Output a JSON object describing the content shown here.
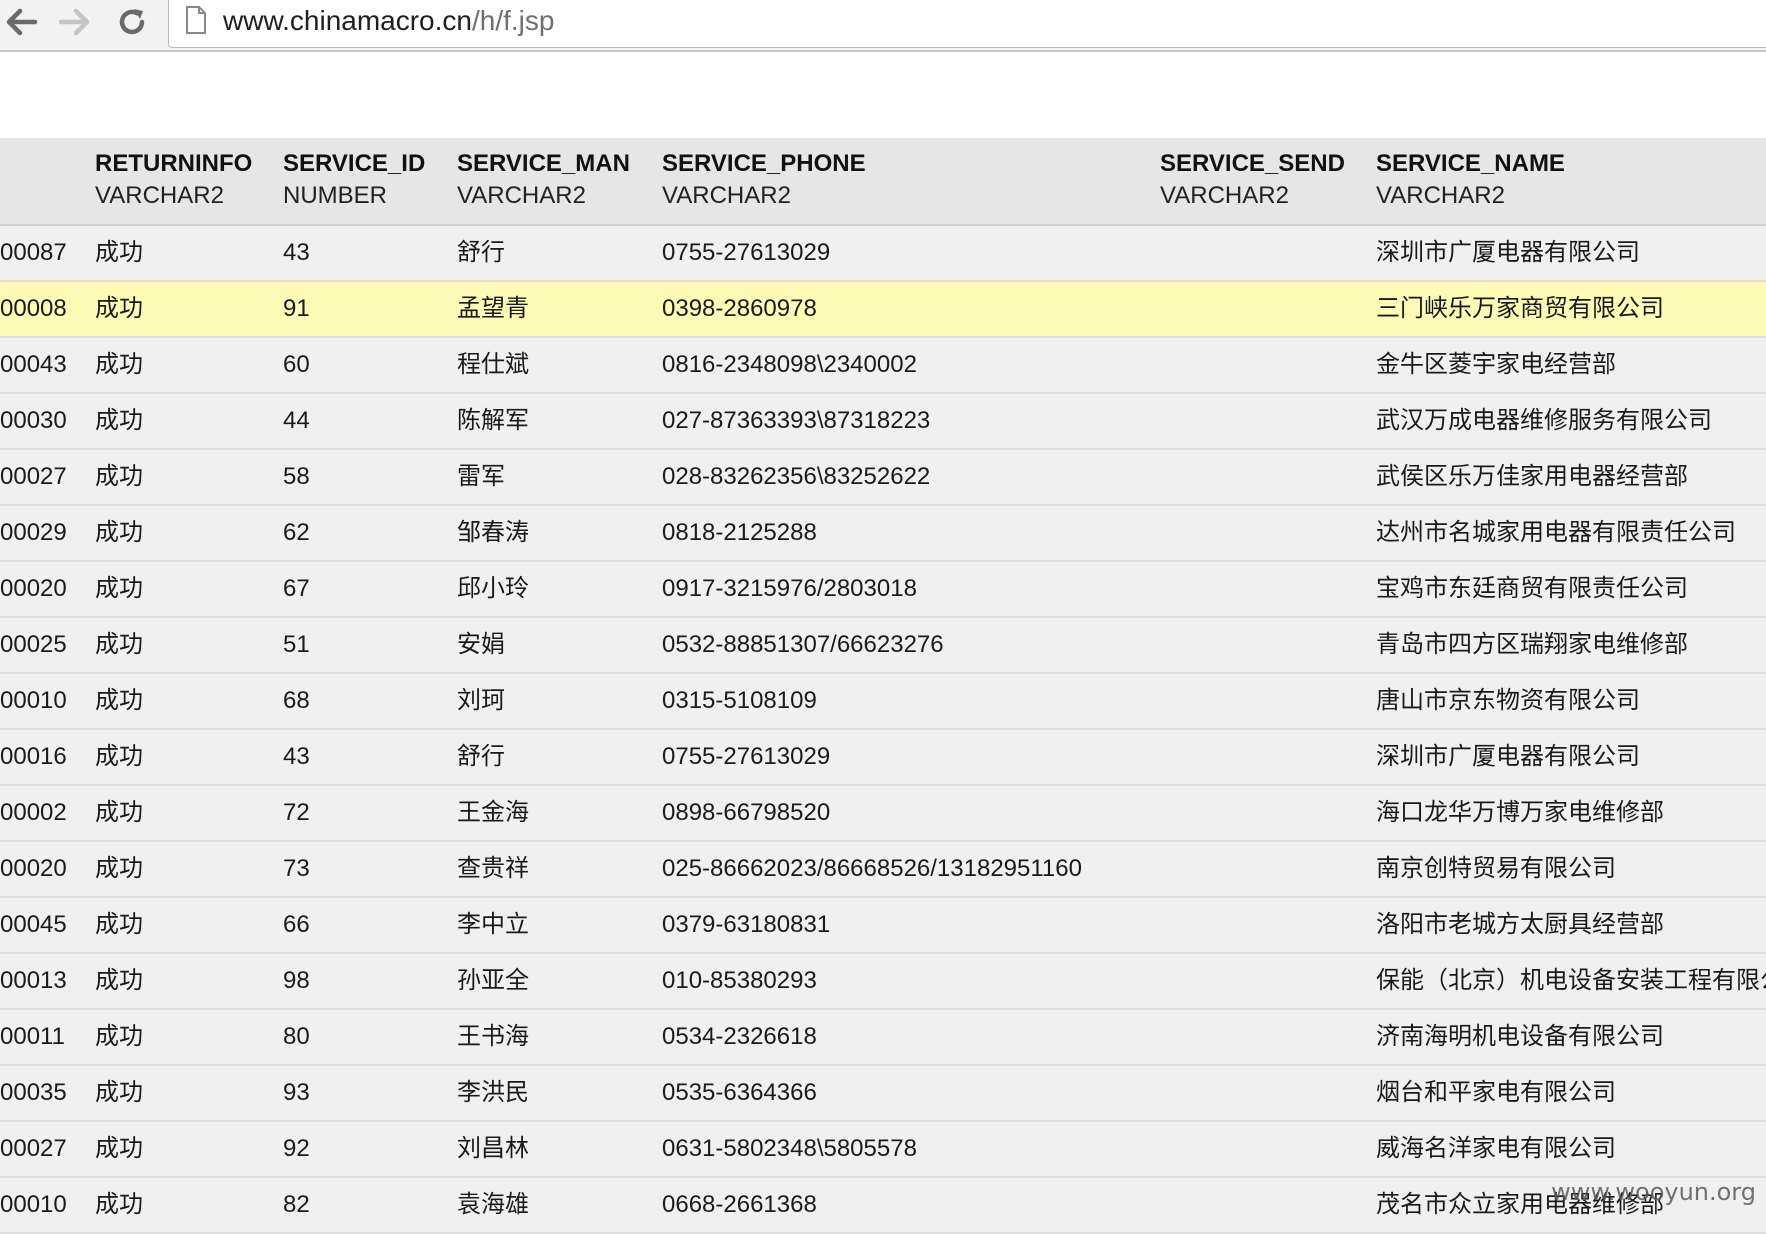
{
  "browser": {
    "url_host": "www.chinamacro.cn",
    "url_path": "/h/f.jsp"
  },
  "table": {
    "columns": [
      {
        "name": "",
        "type": ""
      },
      {
        "name": "RETURNINFO",
        "type": "VARCHAR2"
      },
      {
        "name": "SERVICE_ID",
        "type": "NUMBER"
      },
      {
        "name": "SERVICE_MAN",
        "type": "VARCHAR2"
      },
      {
        "name": "SERVICE_PHONE",
        "type": "VARCHAR2"
      },
      {
        "name": "SERVICE_SEND",
        "type": "VARCHAR2"
      },
      {
        "name": "SERVICE_NAME",
        "type": "VARCHAR2"
      }
    ],
    "rows": [
      [
        "00087",
        "成功",
        "43",
        "舒行",
        "0755-27613029",
        "",
        "深圳市广厦电器有限公司"
      ],
      [
        "00008",
        "成功",
        "91",
        "孟望青",
        "0398-2860978",
        "",
        "三门峡乐万家商贸有限公司"
      ],
      [
        "00043",
        "成功",
        "60",
        "程仕斌",
        "0816-2348098\\2340002",
        "",
        "金牛区菱宇家电经营部"
      ],
      [
        "00030",
        "成功",
        "44",
        "陈解军",
        "027-87363393\\87318223",
        "",
        "武汉万成电器维修服务有限公司"
      ],
      [
        "00027",
        "成功",
        "58",
        "雷军",
        "028-83262356\\83252622",
        "",
        "武侯区乐万佳家用电器经营部"
      ],
      [
        "00029",
        "成功",
        "62",
        "邹春涛",
        "0818-2125288",
        "",
        "达州市名城家用电器有限责任公司"
      ],
      [
        "00020",
        "成功",
        "67",
        "邱小玲",
        "0917-3215976/2803018",
        "",
        "宝鸡市东廷商贸有限责任公司"
      ],
      [
        "00025",
        "成功",
        "51",
        "安娟",
        "0532-88851307/66623276",
        "",
        "青岛市四方区瑞翔家电维修部"
      ],
      [
        "00010",
        "成功",
        "68",
        "刘珂",
        "0315-5108109",
        "",
        "唐山市京东物资有限公司"
      ],
      [
        "00016",
        "成功",
        "43",
        "舒行",
        "0755-27613029",
        "",
        "深圳市广厦电器有限公司"
      ],
      [
        "00002",
        "成功",
        "72",
        "王金海",
        "0898-66798520",
        "",
        "海口龙华万博万家电维修部"
      ],
      [
        "00020",
        "成功",
        "73",
        "查贵祥",
        "025-86662023/86668526/13182951160",
        "",
        "南京创特贸易有限公司"
      ],
      [
        "00045",
        "成功",
        "66",
        "李中立",
        "0379-63180831",
        "",
        "洛阳市老城方太厨具经营部"
      ],
      [
        "00013",
        "成功",
        "98",
        "孙亚全",
        "010-85380293",
        "",
        "保能（北京）机电设备安装工程有限公"
      ],
      [
        "00011",
        "成功",
        "80",
        "王书海",
        "0534-2326618",
        "",
        "济南海明机电设备有限公司"
      ],
      [
        "00035",
        "成功",
        "93",
        "李洪民",
        "0535-6364366",
        "",
        "烟台和平家电有限公司"
      ],
      [
        "00027",
        "成功",
        "92",
        "刘昌林",
        "0631-5802348\\5805578",
        "",
        "威海名洋家电有限公司"
      ],
      [
        "00010",
        "成功",
        "82",
        "袁海雄",
        "0668-2661368",
        "",
        "茂名市众立家用电器维修部"
      ]
    ],
    "highlight_row": 1,
    "highlight_color": "#fdfbb6"
  },
  "watermark": "www.wooyun.org"
}
